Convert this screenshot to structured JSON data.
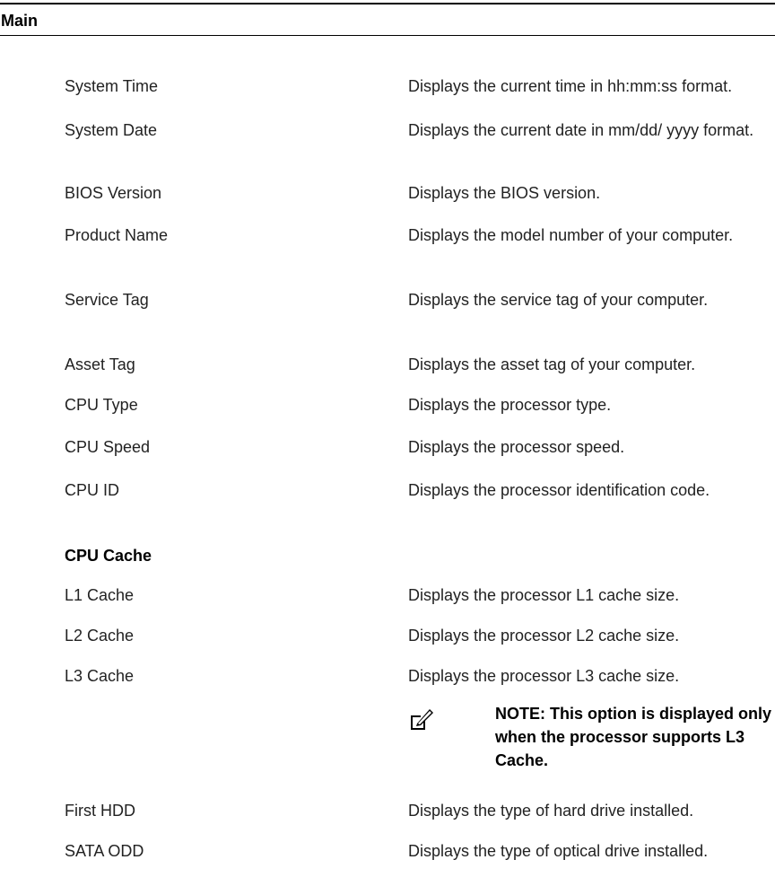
{
  "section_title": "Main",
  "rows_top": [
    {
      "label": "System Time",
      "desc": "Displays the current time in hh:mm:ss format."
    },
    {
      "label": "System Date",
      "desc": "Displays the current date in mm/dd/ yyyy format."
    },
    {
      "label": "BIOS Version",
      "desc": "Displays the BIOS version."
    },
    {
      "label": "Product Name",
      "desc": "Displays the model number of your computer."
    },
    {
      "label": "Service Tag",
      "desc": "Displays the service tag of your computer."
    },
    {
      "label": "Asset Tag",
      "desc": "Displays the asset tag of your computer."
    },
    {
      "label": "CPU Type",
      "desc": "Displays the processor type."
    },
    {
      "label": "CPU Speed",
      "desc": "Displays the processor speed."
    },
    {
      "label": "CPU ID",
      "desc": "Displays the processor identification code."
    }
  ],
  "cpu_cache": {
    "heading": "CPU Cache",
    "rows": [
      {
        "label": "L1 Cache",
        "desc": "Displays the processor L1 cache size."
      },
      {
        "label": "L2 Cache",
        "desc": "Displays the processor L2 cache size."
      },
      {
        "label": "L3 Cache",
        "desc": "Displays the processor L3 cache size."
      }
    ],
    "note": "NOTE: This option is displayed only when the processor supports L3 Cache."
  },
  "rows_bottom": [
    {
      "label": "First HDD",
      "desc": "Displays the type of hard drive installed."
    },
    {
      "label": "SATA ODD",
      "desc": "Displays the type of optical drive installed."
    }
  ],
  "icons": {
    "note": "pencil-note-icon"
  }
}
